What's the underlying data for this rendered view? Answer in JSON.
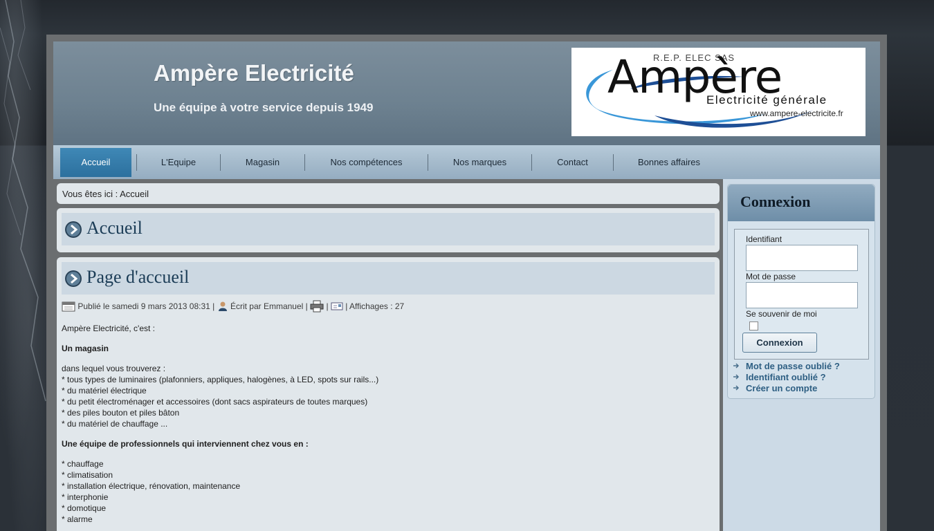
{
  "header": {
    "site_title": "Ampère Electricité",
    "site_slogan": "Une équipe à votre service depuis 1949",
    "logo": {
      "top_text": "R.E.P. ELEC SAS",
      "main_text": "Ampère",
      "sub_text": "Electricité générale",
      "url_text": "www.ampere-electricite.fr"
    }
  },
  "nav": {
    "items": [
      {
        "label": "Accueil",
        "active": true
      },
      {
        "label": "L'Equipe"
      },
      {
        "label": "Magasin"
      },
      {
        "label": "Nos compétences"
      },
      {
        "label": "Nos marques"
      },
      {
        "label": "Contact"
      },
      {
        "label": "Bonnes affaires"
      }
    ]
  },
  "breadcrumb": "Vous êtes ici : Accueil",
  "page_title": "Accueil",
  "article": {
    "title": "Page d'accueil",
    "meta": {
      "published": "Publié le samedi 9 mars 2013 08:31 |",
      "author": "Écrit par Emmanuel |",
      "sep": "|",
      "views": "| Affichages : 27"
    },
    "intro": "Ampère Electricité, c'est :",
    "heading1": "Un magasin",
    "list1_intro": "dans lequel vous trouverez :",
    "list1": [
      "* tous types de luminaires (plafonniers, appliques, halogènes, à LED, spots sur rails...)",
      "* du matériel électrique",
      "* du petit électroménager et accessoires (dont sacs aspirateurs de toutes marques)",
      "* des piles bouton et piles bâton",
      "* du matériel de chauffage ..."
    ],
    "heading2": "Une équipe de professionnels qui interviennent chez vous en :",
    "list2": [
      "* chauffage",
      "* climatisation",
      "* installation électrique, rénovation, maintenance",
      "* interphonie",
      "* domotique",
      "* alarme"
    ]
  },
  "login": {
    "title": "Connexion",
    "username_label": "Identifiant",
    "username_value": "",
    "password_label": "Mot de passe",
    "password_value": "",
    "remember_label": "Se souvenir de moi",
    "submit_label": "Connexion",
    "links": [
      "Mot de passe oublié ?",
      "Identifiant oublié ?",
      "Créer un compte"
    ]
  },
  "colors": {
    "accent": "#2c709e",
    "link": "#2e5f83",
    "title": "#1b3c56"
  },
  "icons": [
    "arrow-circle-icon",
    "calendar-icon",
    "user-icon",
    "print-icon",
    "email-icon",
    "link-arrow-icon"
  ]
}
